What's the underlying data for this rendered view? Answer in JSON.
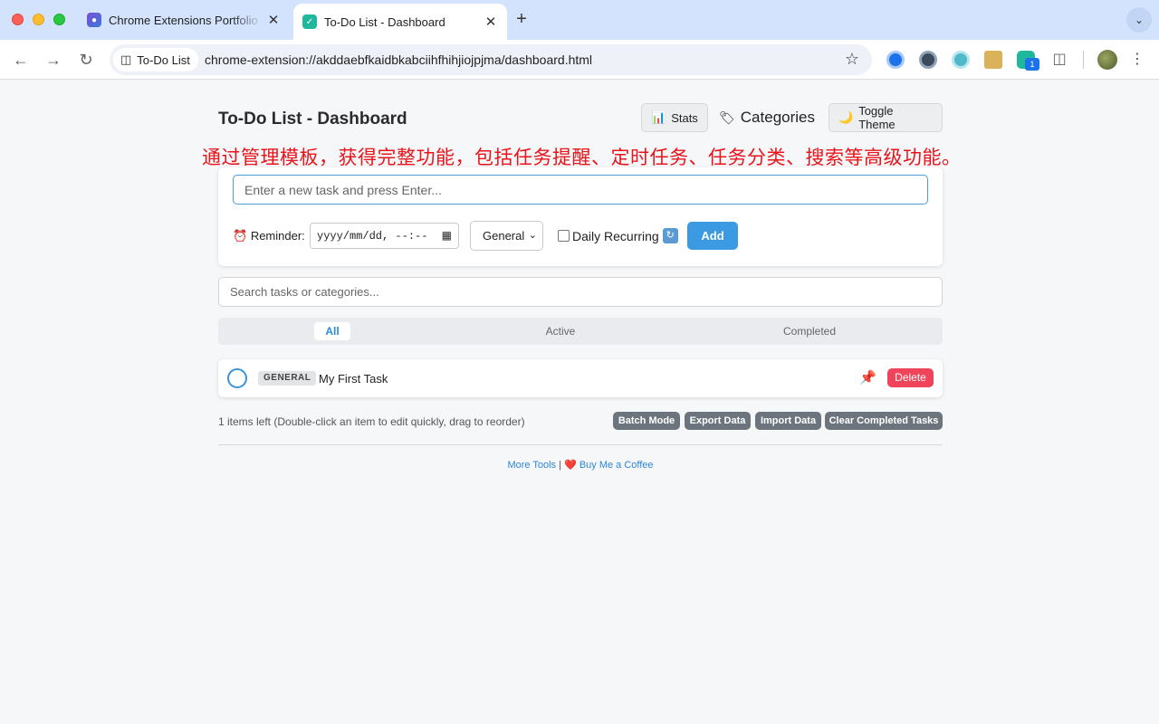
{
  "browser": {
    "tabs": [
      {
        "title": "Chrome Extensions Portfolio | ",
        "icon": "search-extension-icon",
        "active": false
      },
      {
        "title": "To-Do List - Dashboard",
        "icon": "todo-check-icon",
        "active": true
      }
    ],
    "site_chip": "To-Do List",
    "url": "chrome-extension://akddaebfkaidbkabciihfhihjiojpjma/dashboard.html",
    "extension_badge": "1"
  },
  "header": {
    "title": "To-Do List - Dashboard",
    "stats_label": "Stats",
    "categories_label": "Categories",
    "theme_label": "Toggle Theme"
  },
  "promo_text": "通过管理模板，获得完整功能，包括任务提醒、定时任务、任务分类、搜索等高级功能。",
  "add_form": {
    "task_placeholder": "Enter a new task and press Enter...",
    "reminder_label": "Reminder:",
    "date_placeholder": "yyyy/mm/dd, --:--",
    "category_value": "General",
    "recurring_label": "Daily Recurring",
    "add_label": "Add"
  },
  "search": {
    "placeholder": "Search tasks or categories..."
  },
  "filters": {
    "all": "All",
    "active": "Active",
    "completed": "Completed"
  },
  "tasks": [
    {
      "tag": "GENERAL",
      "text": "My First Task",
      "delete_label": "Delete"
    }
  ],
  "footer_bar": {
    "items_left": "1 items left (Double-click an item to edit quickly, drag to reorder)",
    "batch_mode": "Batch Mode",
    "export_data": "Export Data",
    "import_data": "Import Data",
    "clear_completed": "Clear Completed Tasks"
  },
  "footer": {
    "more_tools": "More Tools",
    "separator": "|",
    "buy_coffee": "Buy Me a Coffee"
  },
  "colors": {
    "accent": "#3b9ae1",
    "danger": "#f0445b",
    "promo": "#e8141a",
    "secondary": "#6c757d"
  }
}
